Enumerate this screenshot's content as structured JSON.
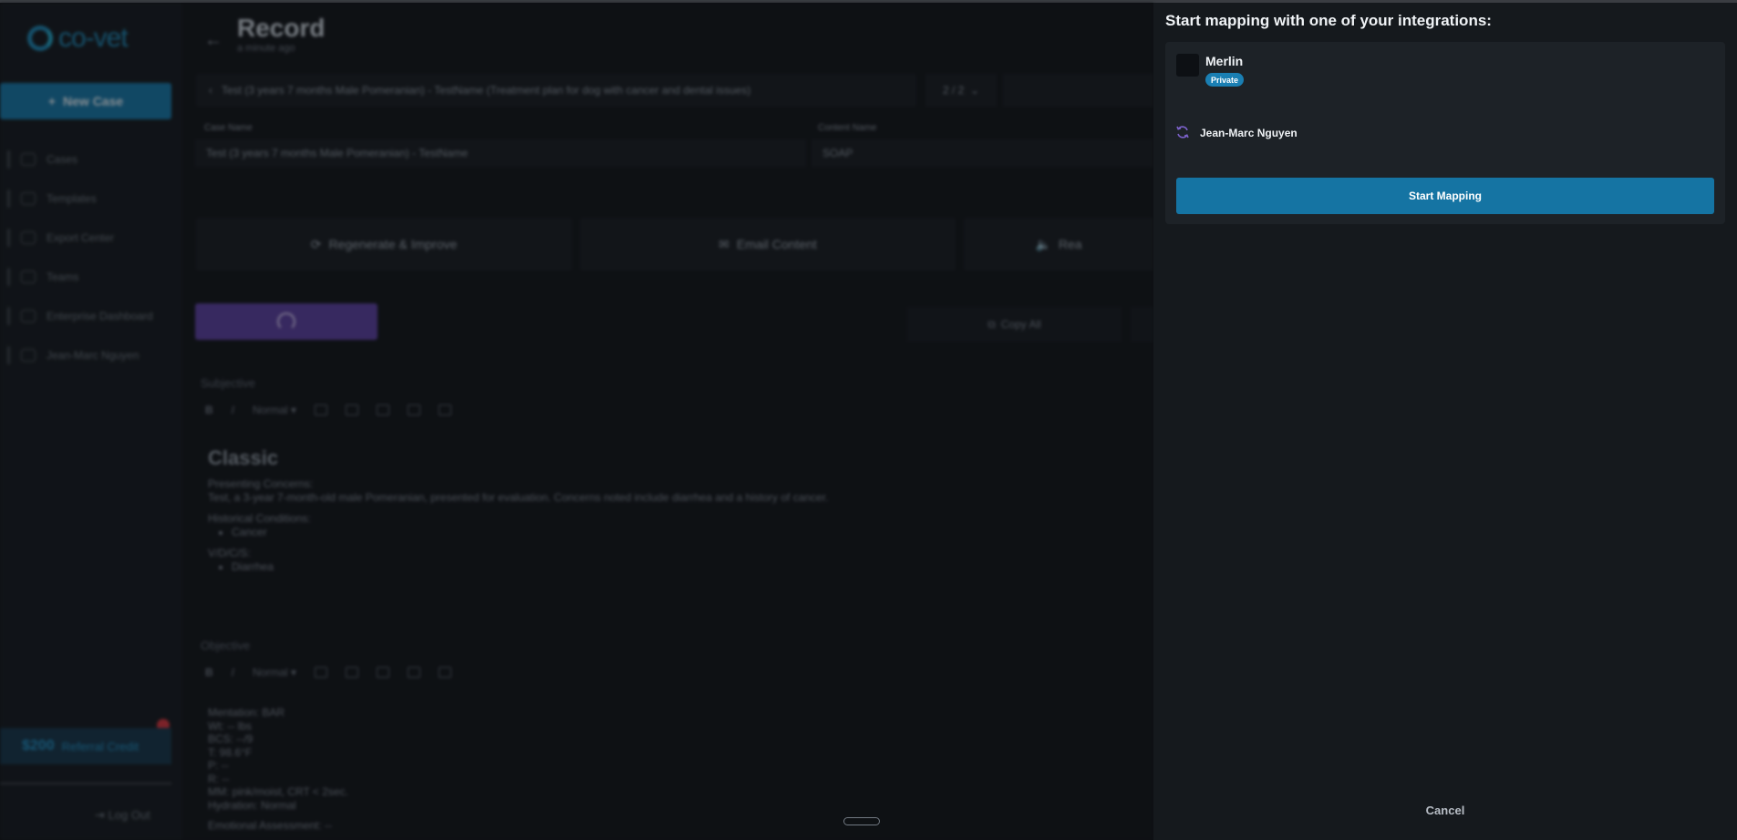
{
  "sidebar": {
    "logo_text": "co-vet",
    "new_case_label": "New Case",
    "items": [
      {
        "label": "Cases",
        "icon": "home-icon"
      },
      {
        "label": "Templates",
        "icon": "templates-icon"
      },
      {
        "label": "Export Center",
        "icon": "export-icon"
      },
      {
        "label": "Teams",
        "icon": "teams-icon"
      },
      {
        "label": "Enterprise Dashboard",
        "icon": "dashboard-icon"
      },
      {
        "label": "Jean-Marc Nguyen",
        "icon": "user-icon"
      }
    ],
    "referral_amount": "$200",
    "referral_label": "Referral Credit",
    "logout_label": "Log Out"
  },
  "record": {
    "title": "Record",
    "subtitle": "a minute ago",
    "case_selector": "Test (3 years 7 months Male Pomeranian) - TestName (Treatment plan for dog with cancer and dental issues)",
    "pager": "2 / 2",
    "case_name_label": "Case Name",
    "case_name_value": "Test (3 years 7 months Male Pomeranian) - TestName",
    "content_name_label": "Content Name",
    "content_name_value": "SOAP",
    "actions": {
      "regenerate": "Regenerate & Improve",
      "email": "Email Content",
      "read": "Rea"
    },
    "copy_all": "Copy All",
    "toolbar_style": "Normal",
    "subjective": {
      "title": "Subjective",
      "heading": "Classic",
      "presenting_label": "Presenting Concerns:",
      "presenting_text": "Test, a 3-year 7-month-old male Pomeranian, presented for evaluation. Concerns noted include diarrhea and a history of cancer.",
      "historical_label": "Historical Conditions:",
      "historical_items": [
        "Cancer"
      ],
      "vdcs_label": "V/D/C/S:",
      "vdcs_items": [
        "Diarrhea"
      ]
    },
    "objective": {
      "title": "Objective",
      "lines": [
        "Mentation: BAR",
        "Wt: -- lbs",
        "BCS: --/9",
        "T: 98.6°F",
        "P: --",
        "R: --",
        "MM: pink/moist, CRT < 2sec.",
        "Hydration: Normal"
      ],
      "emotional": "Emotional Assessment: --"
    }
  },
  "drawer": {
    "title": "Start mapping with one of your integrations:",
    "integration_name": "Merlin",
    "badge": "Private",
    "user_name": "Jean-Marc Nguyen",
    "start_button": "Start Mapping",
    "cancel_label": "Cancel"
  },
  "colors": {
    "accent": "#1574a3",
    "badge": "#1a7fb3",
    "sync_icon": "#7b61c9",
    "drawer_bg": "#15191d"
  }
}
